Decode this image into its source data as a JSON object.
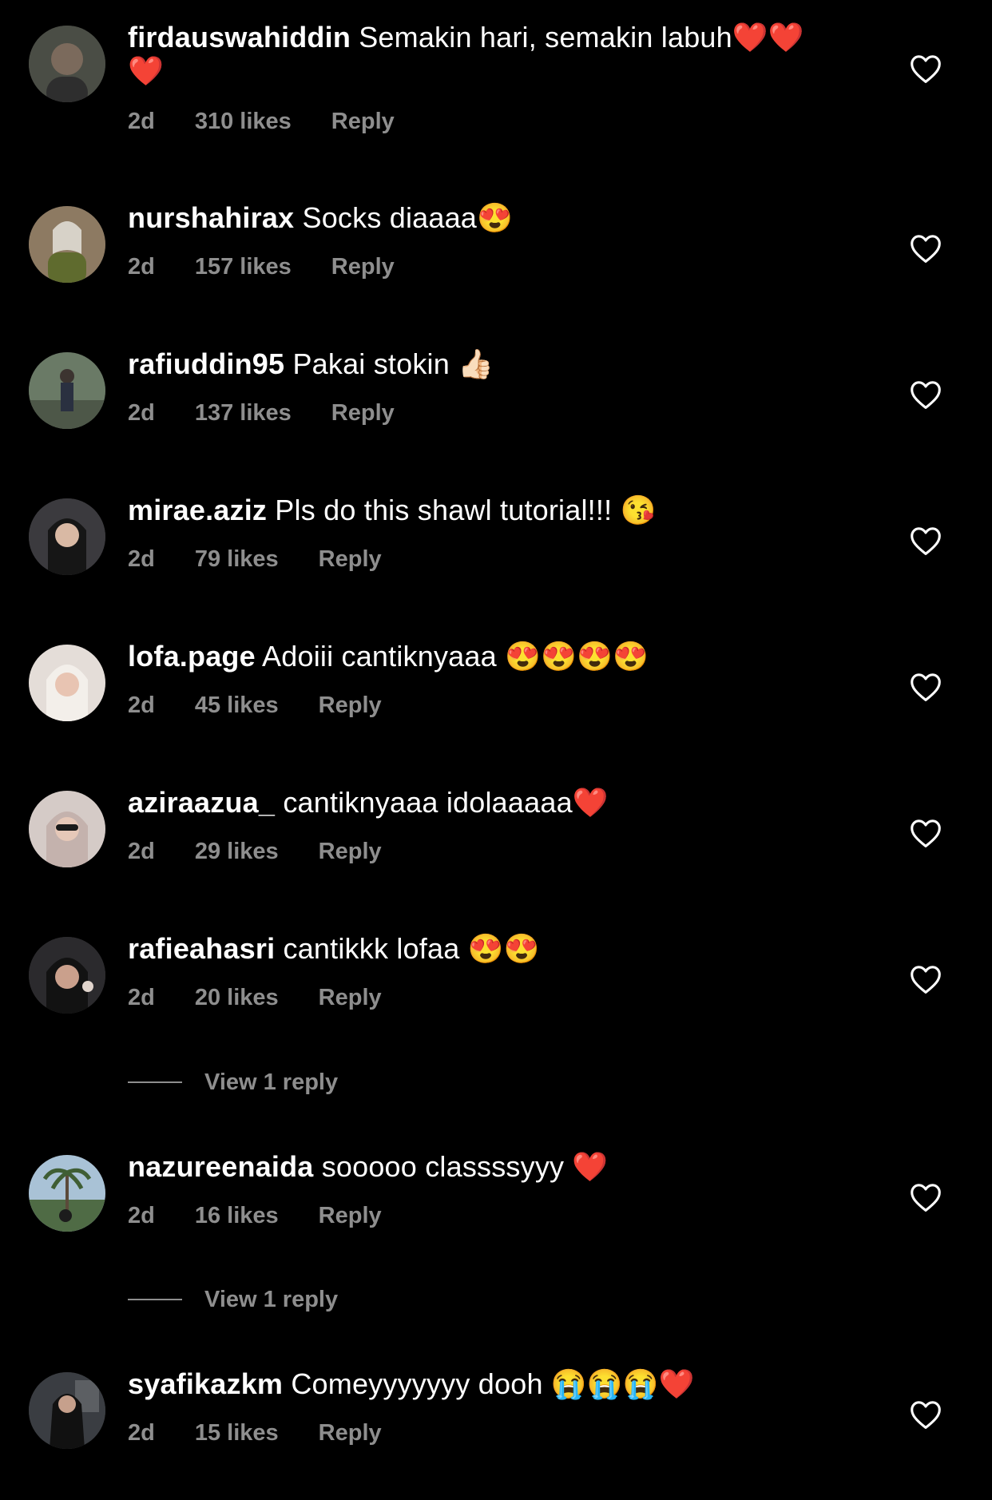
{
  "comments": [
    {
      "username": "firdauswahiddin",
      "text": "Semakin hari, semakin labuh❤️❤️❤️",
      "time": "2d",
      "likes": "310 likes",
      "reply": "Reply",
      "avatar_color": "#4a4d45"
    },
    {
      "username": "nurshahirax",
      "text": "Socks diaaaa😍",
      "time": "2d",
      "likes": "157 likes",
      "reply": "Reply",
      "avatar_color": "#7d6a55"
    },
    {
      "username": "rafiuddin95",
      "text": "Pakai stokin 👍🏻",
      "time": "2d",
      "likes": "137 likes",
      "reply": "Reply",
      "avatar_color": "#5d6b5a"
    },
    {
      "username": "mirae.aziz",
      "text": "Pls do this shawl tutorial!!! 😘",
      "time": "2d",
      "likes": "79 likes",
      "reply": "Reply",
      "avatar_color": "#3b3a3e"
    },
    {
      "username": "lofa.page",
      "text": "Adoiii cantiknyaaa 😍😍😍😍",
      "time": "2d",
      "likes": "45 likes",
      "reply": "Reply",
      "avatar_color": "#d8cfc9"
    },
    {
      "username": "aziraazua_",
      "text": "cantiknyaaa idolaaaaa❤️",
      "time": "2d",
      "likes": "29 likes",
      "reply": "Reply",
      "avatar_color": "#c9bcb8"
    },
    {
      "username": "rafieahasri",
      "text": "cantikkk lofaa 😍😍",
      "time": "2d",
      "likes": "20 likes",
      "reply": "Reply",
      "avatar_color": "#2b2a2d"
    },
    {
      "username": "nazureenaida",
      "text": "sooooo classssyyy ❤️",
      "time": "2d",
      "likes": "16 likes",
      "reply": "Reply",
      "avatar_color": "#6f8a6c"
    },
    {
      "username": "syafikazkm",
      "text": "Comeyyyyyyy dooh 😭😭😭❤️",
      "time": "2d",
      "likes": "15 likes",
      "reply": "Reply",
      "avatar_color": "#2d2f33"
    }
  ],
  "view_replies": [
    {
      "label": "View 1 reply"
    },
    {
      "label": "View 1 reply"
    }
  ],
  "colors": {
    "background": "#000000",
    "text": "#ffffff",
    "secondary": "#8e8e8e"
  }
}
